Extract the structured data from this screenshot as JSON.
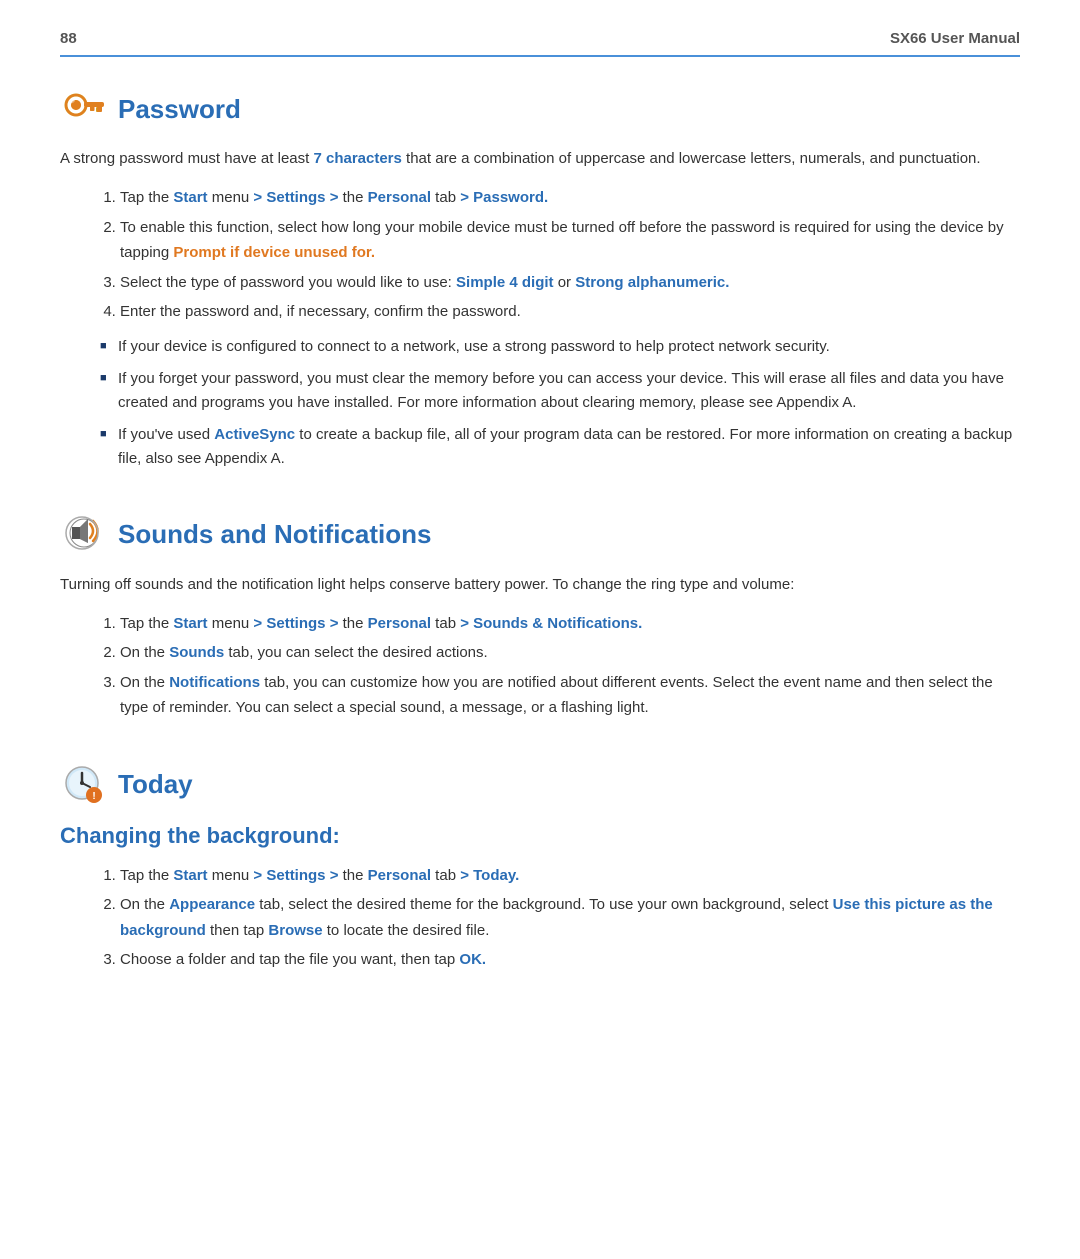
{
  "header": {
    "page_number": "88",
    "title": "SX66 User Manual"
  },
  "sections": [
    {
      "id": "password",
      "title": "Password",
      "icon_label": "password-icon",
      "intro": "A strong password must have at least 7 characters that are a combination of uppercase and lowercase letters, numerals, and punctuation.",
      "intro_highlights": [
        {
          "text": "7 characters",
          "type": "blue"
        }
      ],
      "steps": [
        {
          "text": "Tap the Start menu > Settings > the Personal tab > Password.",
          "highlights": [
            {
              "word": "Start",
              "type": "blue"
            },
            {
              "word": "Settings >",
              "type": "blue"
            },
            {
              "word": "Personal",
              "type": "blue"
            },
            {
              "word": "Password.",
              "type": "blue"
            }
          ]
        },
        {
          "text": "To enable this function, select how long your mobile device must be turned off before the password is required for using the device by tapping Prompt if device unused for.",
          "highlights": [
            {
              "word": "Prompt if device unused for.",
              "type": "orange"
            }
          ]
        },
        {
          "text": "Select the type of password you would like to use: Simple 4 digit or Strong alphanumeric.",
          "highlights": [
            {
              "word": "Simple 4 digit",
              "type": "blue"
            },
            {
              "word": "Strong alphanumeric.",
              "type": "blue"
            }
          ]
        },
        {
          "text": "Enter the password and, if necessary, confirm the password.",
          "highlights": []
        }
      ],
      "bullets": [
        "If your device is configured to connect to a network, use a strong password to help protect network security.",
        "If you forget your password, you must clear the memory before you can access your device. This will erase all files and data you have created and programs you have installed. For more information about clearing memory, please see Appendix A.",
        "If you've used ActiveSync to create a backup file, all of your program data can be restored. For more information on creating a backup file, also see Appendix A."
      ],
      "bullet_highlights": [
        [],
        [],
        [
          {
            "word": "ActiveSync",
            "type": "blue"
          }
        ]
      ]
    },
    {
      "id": "sounds",
      "title": "Sounds and Notifications",
      "icon_label": "sounds-icon",
      "intro": "Turning off sounds and the notification light helps conserve battery power. To change the ring type and volume:",
      "steps": [
        {
          "text": "Tap the Start menu > Settings > the Personal tab > Sounds & Notifications.",
          "highlights": [
            {
              "word": "Start",
              "type": "blue"
            },
            {
              "word": "Settings >",
              "type": "blue"
            },
            {
              "word": "Personal",
              "type": "blue"
            },
            {
              "word": "Sounds & Notifications.",
              "type": "blue"
            }
          ]
        },
        {
          "text": "On the Sounds tab, you can select the desired actions.",
          "highlights": [
            {
              "word": "Sounds",
              "type": "blue"
            }
          ]
        },
        {
          "text": "On the Notifications tab, you can customize how you are notified about different events. Select the event name and then select the type of reminder. You can select a special sound, a message, or a flashing light.",
          "highlights": [
            {
              "word": "Notifications",
              "type": "blue"
            }
          ]
        }
      ],
      "bullets": []
    },
    {
      "id": "today",
      "title": "Today",
      "icon_label": "today-icon",
      "subsection_title": "Changing the background:",
      "intro": "",
      "steps": [
        {
          "text": "Tap the Start menu > Settings > the Personal tab > Today.",
          "highlights": [
            {
              "word": "Start",
              "type": "blue"
            },
            {
              "word": "Settings >",
              "type": "blue"
            },
            {
              "word": "Personal",
              "type": "blue"
            },
            {
              "word": "Today.",
              "type": "blue"
            }
          ]
        },
        {
          "text": "On the Appearance tab, select the desired theme for the background. To use your own background, select Use this picture as the background then tap Browse to locate the desired file.",
          "highlights": [
            {
              "word": "Appearance",
              "type": "blue"
            },
            {
              "word": "Use this picture as the background",
              "type": "blue"
            },
            {
              "word": "Browse",
              "type": "blue"
            }
          ]
        },
        {
          "text": "Choose a folder and tap the file you want, then tap OK.",
          "highlights": [
            {
              "word": "OK.",
              "type": "blue"
            }
          ]
        }
      ],
      "bullets": []
    }
  ]
}
